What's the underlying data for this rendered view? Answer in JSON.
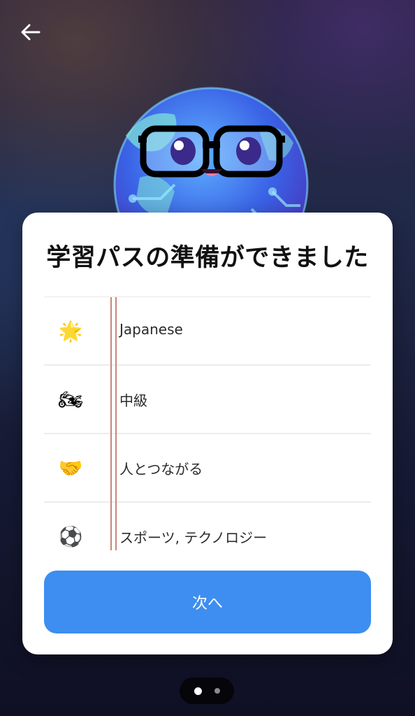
{
  "header": {
    "back_icon": "arrow-left-icon"
  },
  "mascot": {
    "icon": "globe-with-glasses-icon"
  },
  "card": {
    "title": "学習パスの準備ができました",
    "items": [
      {
        "icon": "glowing-star-icon",
        "glyph": "🌟",
        "label": "Japanese"
      },
      {
        "icon": "motorcycle-icon",
        "glyph": "🏍",
        "label": "中級"
      },
      {
        "icon": "handshake-icon",
        "glyph": "🤝",
        "label": "人とつながる"
      },
      {
        "icon": "soccer-ball-icon",
        "glyph": "⚽",
        "label": "スポーツ, テクノロジー"
      }
    ],
    "next_label": "次へ"
  },
  "pager": {
    "current_page": 1,
    "total_pages": 2
  },
  "colors": {
    "accent": "#3d8ef0",
    "card_background": "#ffffff",
    "margin_line": "#c9857d"
  }
}
